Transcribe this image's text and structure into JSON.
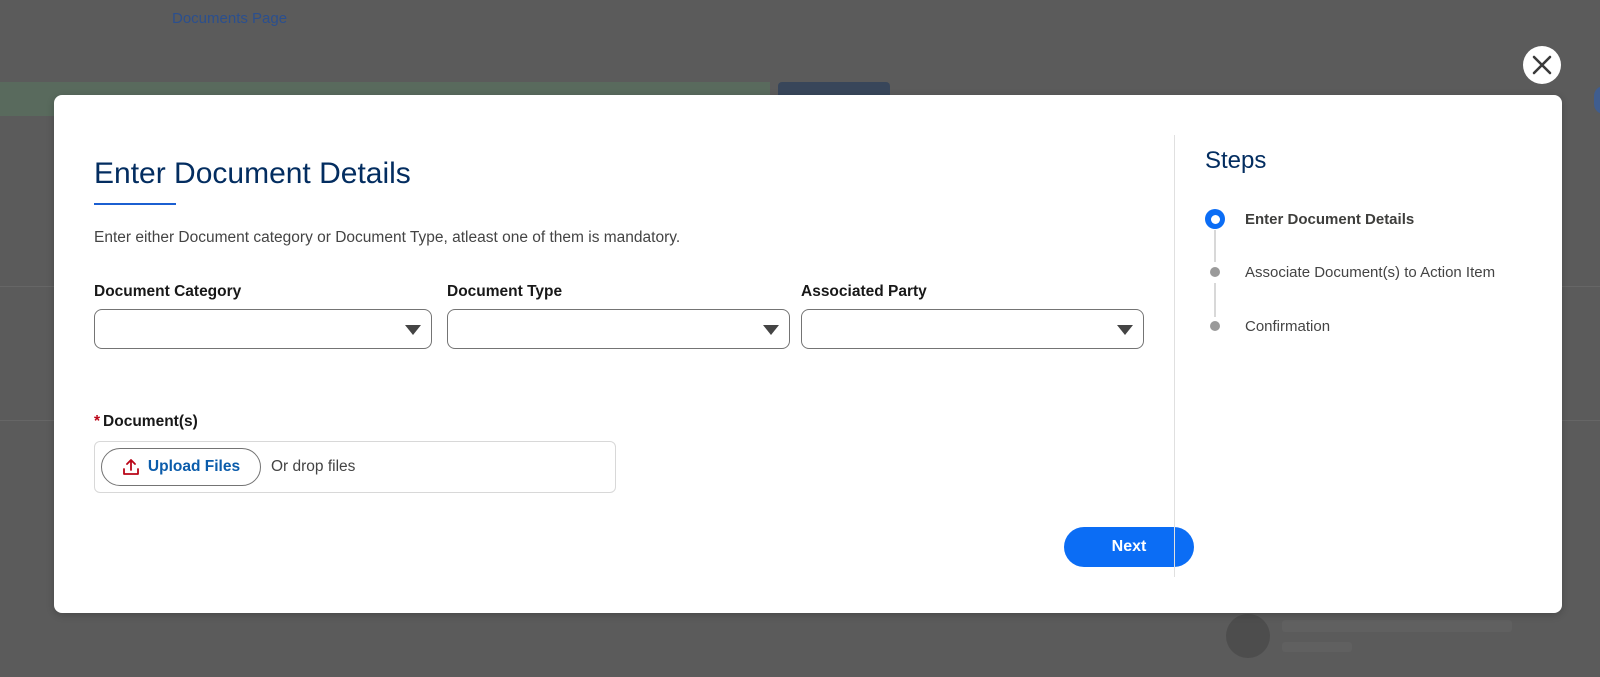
{
  "background": {
    "link_text": "Documents Page"
  },
  "modal": {
    "title": "Enter Document Details",
    "hint": "Enter either Document category or Document Type, atleast one of them is mandatory.",
    "fields": {
      "document_category": {
        "label": "Document Category",
        "value": ""
      },
      "document_type": {
        "label": "Document Type",
        "value": ""
      },
      "associated_party": {
        "label": "Associated Party",
        "value": ""
      }
    },
    "documents": {
      "required_mark": "*",
      "label": "Document(s)",
      "upload_label": "Upload Files",
      "drop_text": "Or drop files"
    },
    "next_label": "Next"
  },
  "steps": {
    "title": "Steps",
    "items": [
      {
        "label": "Enter Document Details",
        "state": "active"
      },
      {
        "label": "Associate Document(s) to Action Item",
        "state": "pending"
      },
      {
        "label": "Confirmation",
        "state": "pending"
      }
    ]
  },
  "colors": {
    "brand_blue": "#0b6df5",
    "title_navy": "#032d60",
    "required_red": "#ba0517",
    "link_blue": "#0b5cab"
  },
  "icons": {
    "close": "close-icon",
    "upload": "upload-icon",
    "caret": "chevron-down-icon"
  }
}
